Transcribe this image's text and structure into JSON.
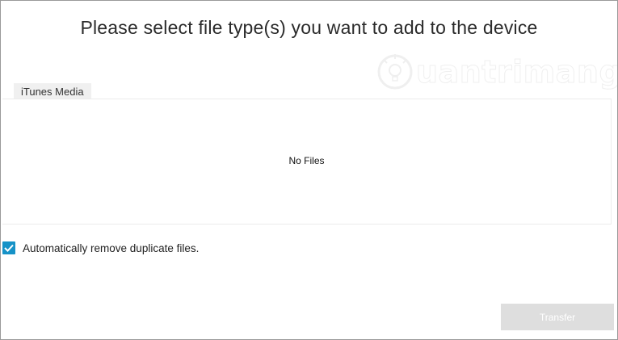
{
  "dialog": {
    "title": "Please select file type(s) you want to add to the device"
  },
  "watermark": {
    "text": "uantrimang",
    "icon": "lightbulb-logo-icon"
  },
  "tabs": [
    {
      "label": "iTunes Media",
      "selected": true
    }
  ],
  "file_list": {
    "empty_message": "No Files"
  },
  "options": {
    "remove_duplicates": {
      "label": "Automatically remove duplicate files.",
      "checked": true,
      "check_color": "#1692c7"
    }
  },
  "actions": {
    "transfer_label": "Transfer",
    "transfer_enabled": false
  }
}
